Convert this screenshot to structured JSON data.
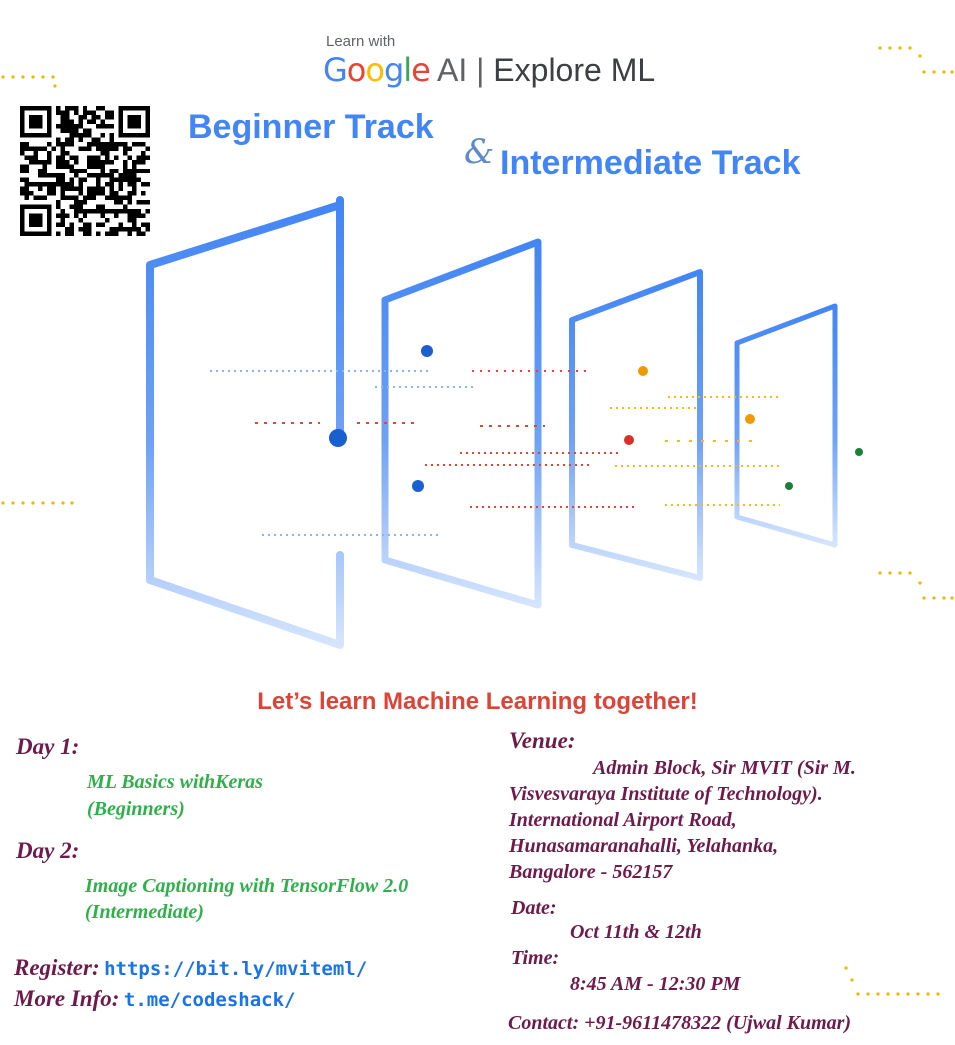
{
  "header": {
    "learn_with": "Learn with",
    "brand_google": [
      "G",
      "o",
      "o",
      "g",
      "l",
      "e"
    ],
    "brand_google_colors": [
      "#4285f4",
      "#ea4335",
      "#fbbc05",
      "#4285f4",
      "#34a853",
      "#ea4335"
    ],
    "brand_ai": "AI",
    "brand_sep": "|",
    "brand_explore": "Explore ML"
  },
  "tracks": {
    "beginner": "Beginner Track",
    "ampersand": "&",
    "intermediate": "Intermediate Track"
  },
  "tagline": "Let’s learn Machine Learning together!",
  "schedule": {
    "day1_label": "Day 1:",
    "day1_title": "ML Basics withKeras",
    "day1_level": "(Beginners)",
    "day2_label": "Day 2:",
    "day2_title": "Image Captioning with TensorFlow 2.0",
    "day2_level": "(Intermediate)"
  },
  "links": {
    "register_label": "Register:",
    "register_url": "https://bit.ly/mviteml/",
    "info_label": "More Info:",
    "info_url": "t.me/codeshack/"
  },
  "venue": {
    "label": "Venue:",
    "line1": "Admin Block, Sir MVIT (Sir M.",
    "line2": "Visvesvaraya Institute of Technology).",
    "line3": "International Airport Road,",
    "line4": "Hunasamaranahalli, Yelahanka,",
    "line5": "Bangalore - 562157"
  },
  "date": {
    "label": "Date:",
    "value": "Oct 11th & 12th"
  },
  "time": {
    "label": "Time:",
    "value": "8:45 AM - 12:30 PM"
  },
  "contact": "Contact: +91-9611478322 (Ujwal Kumar)",
  "colors": {
    "blue": "#4285f4",
    "red": "#db4437",
    "yellow": "#f4b400",
    "green": "#34a853",
    "purple": "#6e1a4a"
  }
}
